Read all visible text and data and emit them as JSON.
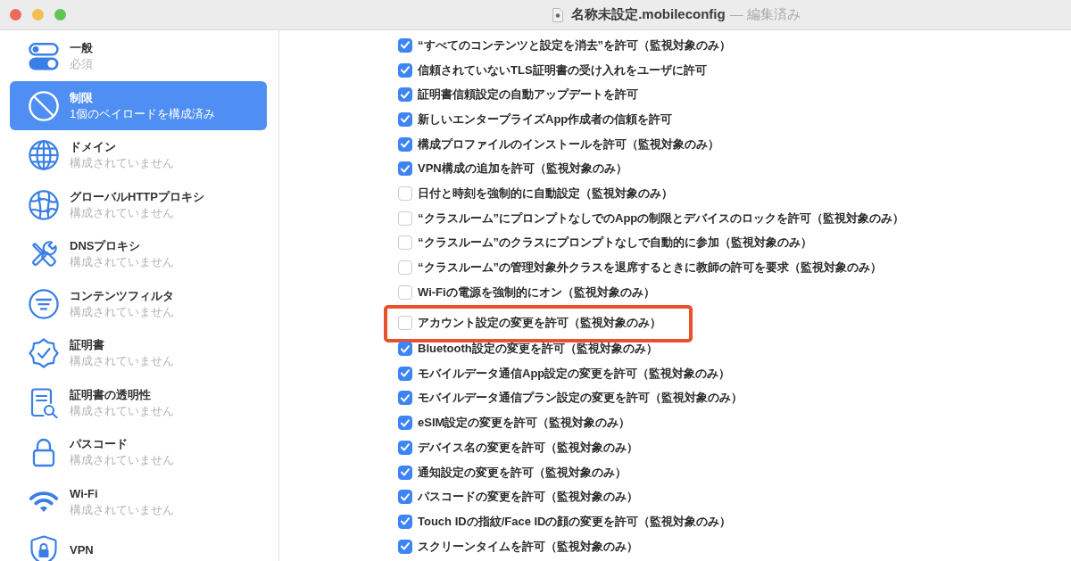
{
  "window": {
    "title": "名称未設定.mobileconfig",
    "status": "— 編集済み"
  },
  "sidebar": {
    "items": [
      {
        "title": "一般",
        "subtitle": "必須",
        "selected": false
      },
      {
        "title": "制限",
        "subtitle": "1個のペイロードを構成済み",
        "selected": true
      },
      {
        "title": "ドメイン",
        "subtitle": "構成されていません",
        "selected": false
      },
      {
        "title": "グローバルHTTPプロキシ",
        "subtitle": "構成されていません",
        "selected": false
      },
      {
        "title": "DNSプロキシ",
        "subtitle": "構成されていません",
        "selected": false
      },
      {
        "title": "コンテンツフィルタ",
        "subtitle": "構成されていません",
        "selected": false
      },
      {
        "title": "証明書",
        "subtitle": "構成されていません",
        "selected": false
      },
      {
        "title": "証明書の透明性",
        "subtitle": "構成されていません",
        "selected": false
      },
      {
        "title": "パスコード",
        "subtitle": "構成されていません",
        "selected": false
      },
      {
        "title": "Wi-Fi",
        "subtitle": "構成されていません",
        "selected": false
      },
      {
        "title": "VPN",
        "selected": false
      }
    ]
  },
  "restrictions": [
    {
      "label": "“すべてのコンテンツと設定を消去”を許可（監視対象のみ）",
      "checked": true,
      "highlighted": false
    },
    {
      "label": "信頼されていないTLS証明書の受け入れをユーザに許可",
      "checked": true,
      "highlighted": false
    },
    {
      "label": "証明書信頼設定の自動アップデートを許可",
      "checked": true,
      "highlighted": false
    },
    {
      "label": "新しいエンタープライズApp作成者の信頼を許可",
      "checked": true,
      "highlighted": false
    },
    {
      "label": "構成プロファイルのインストールを許可（監視対象のみ）",
      "checked": true,
      "highlighted": false
    },
    {
      "label": "VPN構成の追加を許可（監視対象のみ）",
      "checked": true,
      "highlighted": false
    },
    {
      "label": "日付と時刻を強制的に自動設定（監視対象のみ）",
      "checked": false,
      "highlighted": false
    },
    {
      "label": "“クラスルーム”にプロンプトなしでのAppの制限とデバイスのロックを許可（監視対象のみ）",
      "checked": false,
      "highlighted": false
    },
    {
      "label": "“クラスルーム”のクラスにプロンプトなしで自動的に参加（監視対象のみ）",
      "checked": false,
      "highlighted": false
    },
    {
      "label": "“クラスルーム”の管理対象外クラスを退席するときに教師の許可を要求（監視対象のみ）",
      "checked": false,
      "highlighted": false
    },
    {
      "label": "Wi-Fiの電源を強制的にオン（監視対象のみ）",
      "checked": false,
      "highlighted": false
    },
    {
      "label": "アカウント設定の変更を許可（監視対象のみ）",
      "checked": false,
      "highlighted": true
    },
    {
      "label": "Bluetooth設定の変更を許可（監視対象のみ）",
      "checked": true,
      "highlighted": false
    },
    {
      "label": "モバイルデータ通信App設定の変更を許可（監視対象のみ）",
      "checked": true,
      "highlighted": false
    },
    {
      "label": "モバイルデータ通信プラン設定の変更を許可（監視対象のみ）",
      "checked": true,
      "highlighted": false
    },
    {
      "label": "eSIM設定の変更を許可（監視対象のみ）",
      "checked": true,
      "highlighted": false
    },
    {
      "label": "デバイス名の変更を許可（監視対象のみ）",
      "checked": true,
      "highlighted": false
    },
    {
      "label": "通知設定の変更を許可（監視対象のみ）",
      "checked": true,
      "highlighted": false
    },
    {
      "label": "パスコードの変更を許可（監視対象のみ）",
      "checked": true,
      "highlighted": false
    },
    {
      "label": "Touch IDの指紋/Face IDの顔の変更を許可（監視対象のみ）",
      "checked": true,
      "highlighted": false
    },
    {
      "label": "スクリーンタイムを許可（監視対象のみ）",
      "checked": true,
      "highlighted": false
    }
  ]
}
